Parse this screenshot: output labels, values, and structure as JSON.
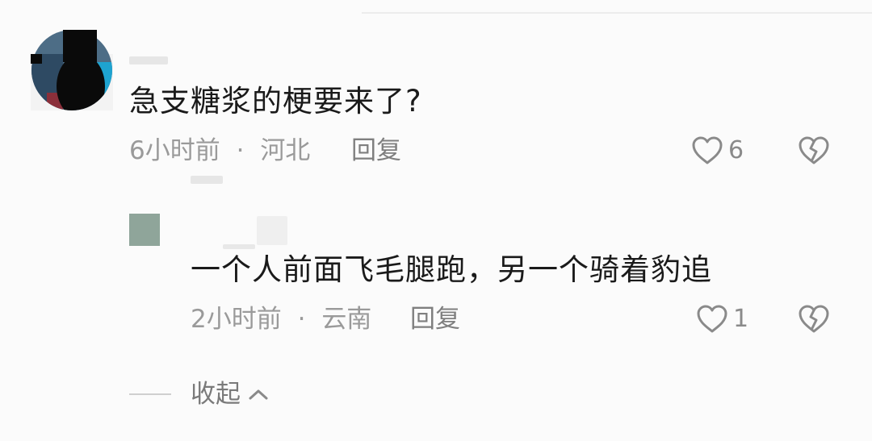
{
  "comment": {
    "text": "急支糖浆的梗要来了?",
    "time": "6小时前",
    "separator": "·",
    "location": "河北",
    "reply_label": "回复",
    "like_count": "6",
    "like_icon": "heart-outline-icon",
    "dislike_icon": "broken-heart-icon"
  },
  "reply": {
    "text": "一个人前面飞毛腿跑，另一个骑着豹追",
    "time": "2小时前",
    "separator": "·",
    "location": "云南",
    "reply_label": "回复",
    "like_count": "1",
    "like_icon": "heart-outline-icon",
    "dislike_icon": "broken-heart-icon"
  },
  "collapse": {
    "label": "收起",
    "icon": "chevron-up-icon"
  },
  "colors": {
    "background": "#fbfbfb",
    "text_primary": "#1a1a1a",
    "text_meta": "#9a9a9a",
    "reply_avatar": "#8fa59a"
  }
}
